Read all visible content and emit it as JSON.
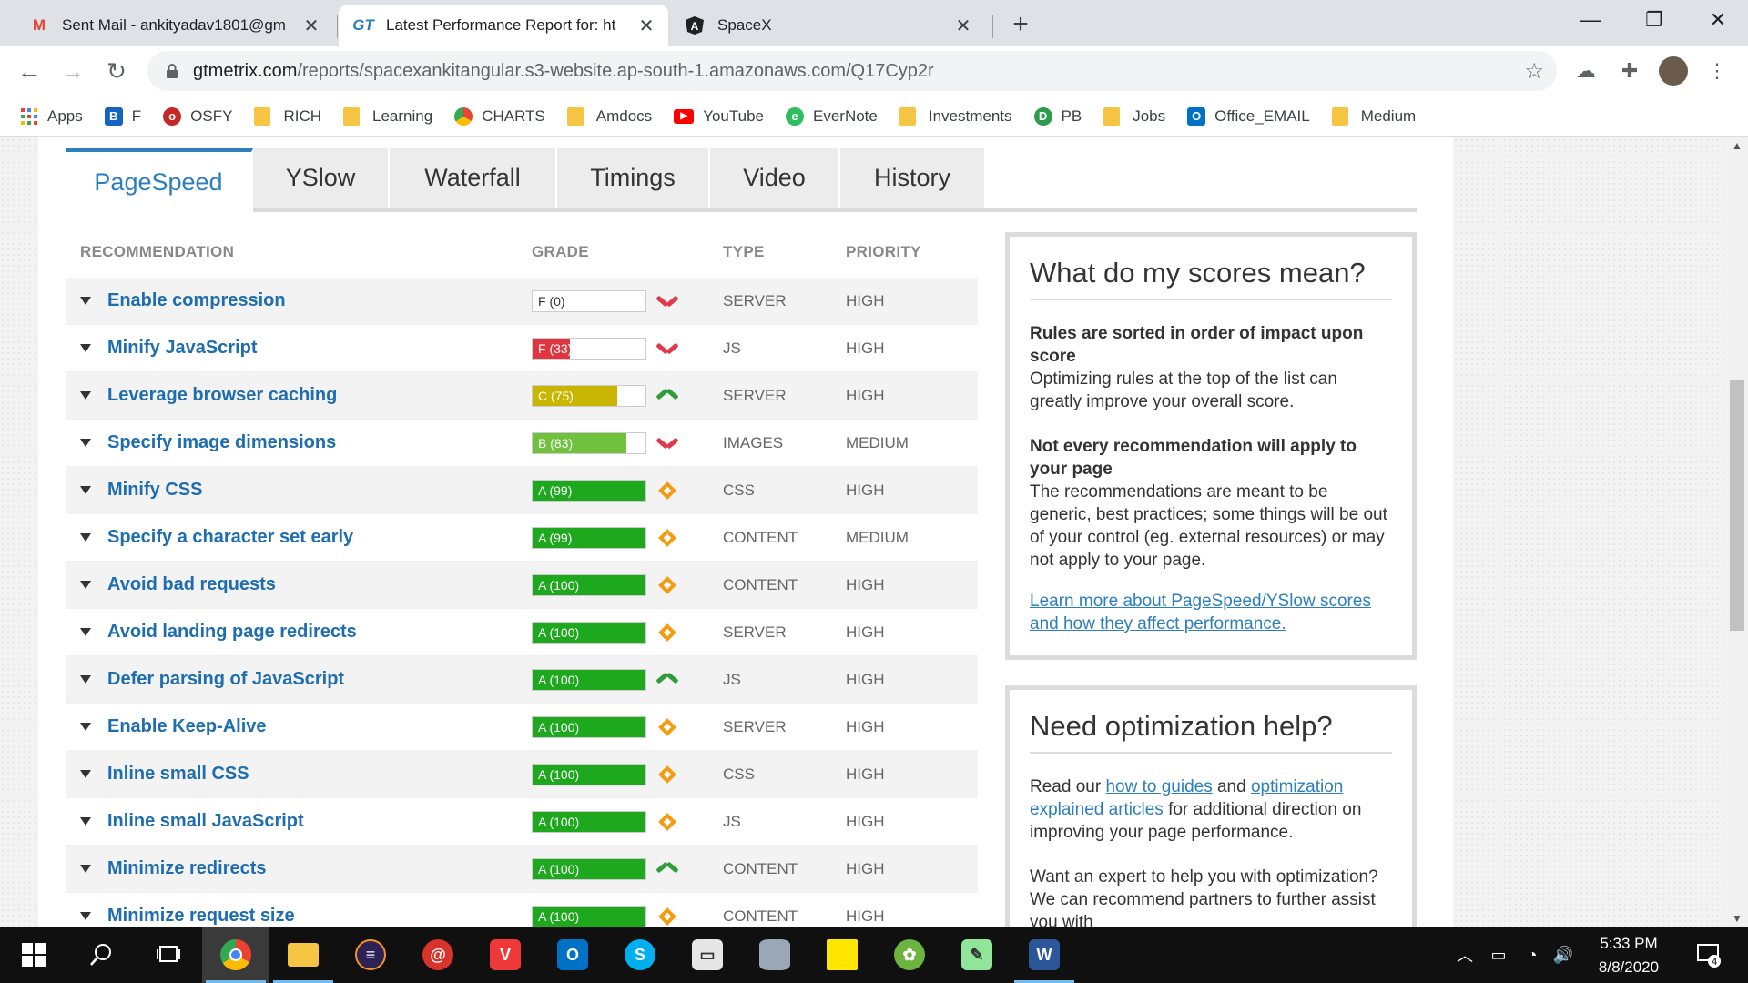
{
  "browser": {
    "tabs": [
      {
        "title": "Sent Mail - ankityadav1801@gm",
        "icon": "gmail-icon",
        "icon_color": "#ea4335",
        "active": false
      },
      {
        "title": "Latest Performance Report for: ht",
        "icon": "gtmetrix-icon",
        "icon_color": "#2b7fbd",
        "active": true
      },
      {
        "title": "SpaceX",
        "icon": "angular-icon",
        "icon_color": "#202124",
        "active": false
      }
    ],
    "url_host": "gtmetrix.com",
    "url_path": "/reports/spacexankitangular.s3-website.ap-south-1.amazonaws.com/Q17Cyp2r",
    "bookmarks": [
      {
        "label": "Apps",
        "icon": "apps-grid-icon"
      },
      {
        "label": "F",
        "icon": "f-icon"
      },
      {
        "label": "OSFY",
        "icon": "osfy-icon"
      },
      {
        "label": "RICH",
        "icon": "folder-icon"
      },
      {
        "label": "Learning",
        "icon": "folder-icon"
      },
      {
        "label": "CHARTS",
        "icon": "charts-icon"
      },
      {
        "label": "Amdocs",
        "icon": "folder-icon"
      },
      {
        "label": "YouTube",
        "icon": "youtube-icon"
      },
      {
        "label": "EverNote",
        "icon": "evernote-icon"
      },
      {
        "label": "Investments",
        "icon": "folder-icon"
      },
      {
        "label": "PB",
        "icon": "pb-icon"
      },
      {
        "label": "Jobs",
        "icon": "folder-icon"
      },
      {
        "label": "Office_EMAIL",
        "icon": "outlook-icon"
      },
      {
        "label": "Medium",
        "icon": "folder-icon"
      }
    ]
  },
  "report": {
    "tabs": [
      "PageSpeed",
      "YSlow",
      "Waterfall",
      "Timings",
      "Video",
      "History"
    ],
    "active_tab": "PageSpeed",
    "headers": {
      "recommendation": "RECOMMENDATION",
      "grade": "GRADE",
      "type": "TYPE",
      "priority": "PRIORITY"
    },
    "rows": [
      {
        "name": "Enable compression",
        "grade": "F (0)",
        "score": 0,
        "trend": "down",
        "type": "SERVER",
        "priority": "HIGH"
      },
      {
        "name": "Minify JavaScript",
        "grade": "F (33)",
        "score": 33,
        "trend": "down",
        "type": "JS",
        "priority": "HIGH"
      },
      {
        "name": "Leverage browser caching",
        "grade": "C (75)",
        "score": 75,
        "trend": "up",
        "type": "SERVER",
        "priority": "HIGH"
      },
      {
        "name": "Specify image dimensions",
        "grade": "B (83)",
        "score": 83,
        "trend": "down",
        "type": "IMAGES",
        "priority": "MEDIUM"
      },
      {
        "name": "Minify CSS",
        "grade": "A (99)",
        "score": 99,
        "trend": "same",
        "type": "CSS",
        "priority": "HIGH"
      },
      {
        "name": "Specify a character set early",
        "grade": "A (99)",
        "score": 99,
        "trend": "same",
        "type": "CONTENT",
        "priority": "MEDIUM"
      },
      {
        "name": "Avoid bad requests",
        "grade": "A (100)",
        "score": 100,
        "trend": "same",
        "type": "CONTENT",
        "priority": "HIGH"
      },
      {
        "name": "Avoid landing page redirects",
        "grade": "A (100)",
        "score": 100,
        "trend": "same",
        "type": "SERVER",
        "priority": "HIGH"
      },
      {
        "name": "Defer parsing of JavaScript",
        "grade": "A (100)",
        "score": 100,
        "trend": "up",
        "type": "JS",
        "priority": "HIGH"
      },
      {
        "name": "Enable Keep-Alive",
        "grade": "A (100)",
        "score": 100,
        "trend": "same",
        "type": "SERVER",
        "priority": "HIGH"
      },
      {
        "name": "Inline small CSS",
        "grade": "A (100)",
        "score": 100,
        "trend": "same",
        "type": "CSS",
        "priority": "HIGH"
      },
      {
        "name": "Inline small JavaScript",
        "grade": "A (100)",
        "score": 100,
        "trend": "same",
        "type": "JS",
        "priority": "HIGH"
      },
      {
        "name": "Minimize redirects",
        "grade": "A (100)",
        "score": 100,
        "trend": "up",
        "type": "CONTENT",
        "priority": "HIGH"
      },
      {
        "name": "Minimize request size",
        "grade": "A (100)",
        "score": 100,
        "trend": "same",
        "type": "CONTENT",
        "priority": "HIGH"
      }
    ],
    "grade_colors": {
      "F": "#e0343f",
      "C": "#c9b600",
      "B": "#6fc13e",
      "A": "#1ea81e"
    },
    "scores_box": {
      "title": "What do my scores mean?",
      "p1_bold": "Rules are sorted in order of impact upon score",
      "p1_text": "Optimizing rules at the top of the list can greatly improve your overall score.",
      "p2_bold": "Not every recommendation will apply to your page",
      "p2_text": "The recommendations are meant to be generic, best practices; some things will be out of your control (eg. external resources) or may not apply to your page.",
      "link": "Learn more about PageSpeed/YSlow scores and how they affect performance."
    },
    "help_box": {
      "title": "Need optimization help?",
      "p1_pre": "Read our ",
      "link1": "how to guides",
      "p1_mid": " and ",
      "link2": "optimization explained articles",
      "p1_post": " for additional direction on improving your page performance.",
      "p2": "Want an expert to help you with optimization? We can recommend partners to further assist you with"
    }
  },
  "taskbar": {
    "apps": [
      "windows-start-icon",
      "search-icon",
      "task-view-icon",
      "chrome-icon",
      "file-explorer-icon",
      "eclipse-icon",
      "git-icon",
      "vivaldi-icon",
      "outlook-icon",
      "skype-icon",
      "terminal-icon",
      "database-icon",
      "sticky-notes-icon",
      "spring-icon",
      "notepad-plus-icon",
      "word-icon"
    ],
    "time": "5:33 PM",
    "date": "8/8/2020",
    "notifications": "4"
  }
}
